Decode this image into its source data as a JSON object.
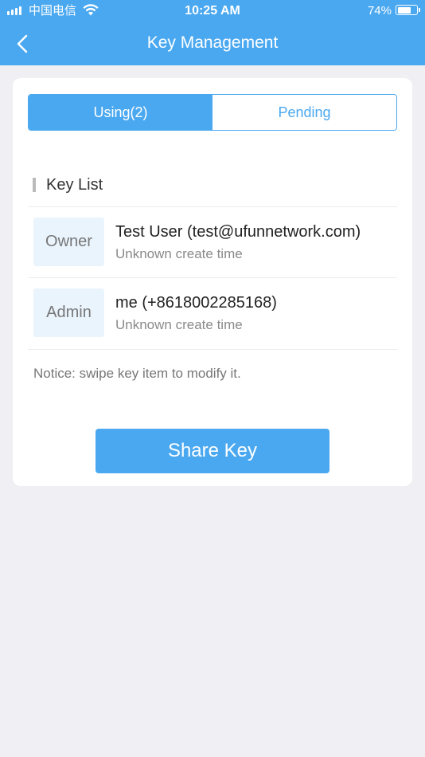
{
  "status_bar": {
    "carrier": "中国电信",
    "time": "10:25 AM",
    "battery_pct": "74%",
    "battery_level": 0.74
  },
  "nav": {
    "title": "Key Management",
    "back_icon": "chevron-left-icon"
  },
  "tabs": [
    {
      "label": "Using(2)",
      "active": true
    },
    {
      "label": "Pending",
      "active": false
    }
  ],
  "section_title": "Key List",
  "keys": [
    {
      "role": "Owner",
      "name": "Test User (test@ufunnetwork.com)",
      "time": "Unknown create time"
    },
    {
      "role": "Admin",
      "name": "me (+8618002285168)",
      "time": "Unknown create time"
    }
  ],
  "notice": "Notice: swipe key item to modify it.",
  "share_button": "Share Key",
  "colors": {
    "accent": "#4aa8f0",
    "background": "#efeff4",
    "role_box": "#eaf4fd"
  }
}
